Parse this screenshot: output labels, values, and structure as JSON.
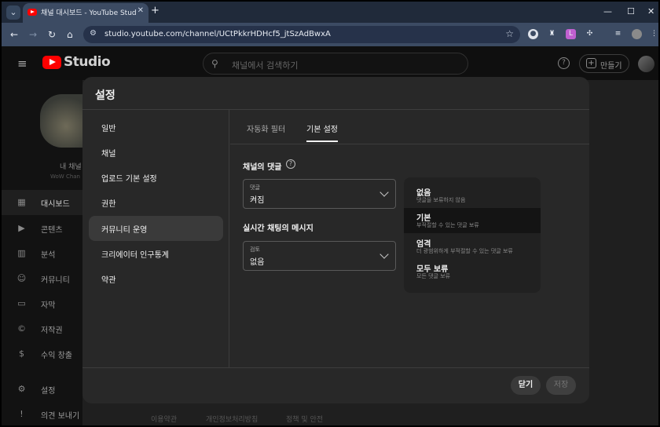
{
  "browser": {
    "tab_title": "채널 대시보드 - YouTube Studio",
    "url": "studio.youtube.com/channel/UCtPkkrHDHcf5_jtSzAdBwxA"
  },
  "header": {
    "app_name": "Studio",
    "search_placeholder": "채널에서 검색하기",
    "help_glyph": "?",
    "create_label": "만들기"
  },
  "sidebar": {
    "channel_name": "내 채널",
    "channel_sub": "WoW Chan",
    "items": [
      {
        "label": "대시보드",
        "icon": "dashboard-icon"
      },
      {
        "label": "콘텐츠",
        "icon": "content-icon"
      },
      {
        "label": "분석",
        "icon": "analytics-icon"
      },
      {
        "label": "커뮤니티",
        "icon": "community-icon"
      },
      {
        "label": "자막",
        "icon": "subtitles-icon"
      },
      {
        "label": "저작권",
        "icon": "copyright-icon"
      },
      {
        "label": "수익 창출",
        "icon": "monetization-icon"
      },
      {
        "label": "설정",
        "icon": "settings-icon"
      },
      {
        "label": "의견 보내기",
        "icon": "feedback-icon"
      }
    ]
  },
  "footer": {
    "links": [
      "이용약관",
      "개인정보처리방침",
      "정책 및 안전"
    ]
  },
  "modal": {
    "title": "설정",
    "nav": [
      "일반",
      "채널",
      "업로드 기본 설정",
      "권한",
      "커뮤니티 운영",
      "크리에이터 인구통계",
      "약관"
    ],
    "tabs": [
      "자동화 필터",
      "기본 설정"
    ],
    "section_comments": "채널의 댓글",
    "comments_dropdown": {
      "label": "댓글",
      "value": "켜짐"
    },
    "section_chat": "실시간 채팅의 메시지",
    "chat_dropdown": {
      "label": "검토",
      "value": "없음"
    },
    "options": [
      {
        "title": "없음",
        "desc": "댓글을 보류하지 않음"
      },
      {
        "title": "기본",
        "desc": "부적절할 수 있는 댓글 보류"
      },
      {
        "title": "엄격",
        "desc": "더 광범위하게 부적절할 수 있는 댓글 보류"
      },
      {
        "title": "모두 보류",
        "desc": "모든 댓글 보류"
      }
    ],
    "close_label": "닫기",
    "save_label": "저장"
  },
  "colors": {
    "brand": "#ff0000",
    "modal_bg": "#282828",
    "page_bg": "#0f0f0f"
  }
}
